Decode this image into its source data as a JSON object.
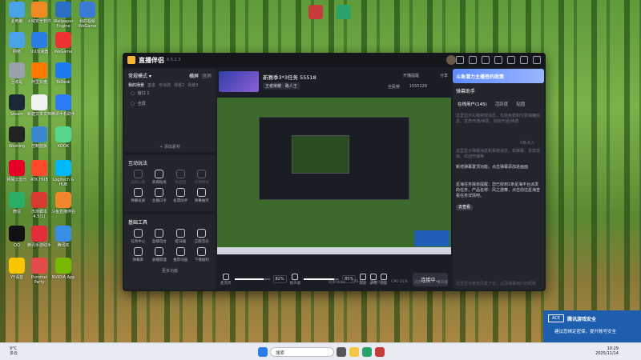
{
  "desktop": {
    "icons": [
      {
        "label": "此电脑",
        "color": "#4aa3e8"
      },
      {
        "label": "火绒安全软件",
        "color": "#f08a24"
      },
      {
        "label": "Wallpaper Engine",
        "color": "#2b6fc2"
      },
      {
        "label": "我的视频WeGame",
        "color": "#3a7bd5"
      },
      {
        "label": "网络",
        "color": "#4aa3e8"
      },
      {
        "label": "UU加速器",
        "color": "#2a7de1"
      },
      {
        "label": "WeGame",
        "color": "#e33"
      },
      {
        "label": "回收站",
        "color": "#9aa0ad"
      },
      {
        "label": "阿里云盘",
        "color": "#ff7a00"
      },
      {
        "label": "ToDesk",
        "color": "#1f7cf0"
      },
      {
        "label": "Steam",
        "color": "#1b2838"
      },
      {
        "label": "新建文本文档",
        "color": "#f2f2f2"
      },
      {
        "label": "腾讯手机助手",
        "color": "#2d7cf6"
      },
      {
        "label": "Wooting",
        "color": "#222"
      },
      {
        "label": "控制面板",
        "color": "#3a89d0"
      },
      {
        "label": "KOOK",
        "color": "#58d68d"
      },
      {
        "label": "网易云音乐",
        "color": "#e60026"
      },
      {
        "label": "ATK HUB",
        "color": "#ff4b2b"
      },
      {
        "label": "Logitech G HUB",
        "color": "#00b8fc"
      },
      {
        "label": "微信",
        "color": "#2aae67"
      },
      {
        "label": "市场脚本 4.5(1)",
        "color": "#d83a2f"
      },
      {
        "label": "斗鱼直播伴侣",
        "color": "#f2862c"
      },
      {
        "label": "QQ",
        "color": "#111"
      },
      {
        "label": "腾讯手游助手",
        "color": "#e12d39"
      },
      {
        "label": "腾讯欢",
        "color": "#3a8ee6"
      },
      {
        "label": "YY语音",
        "color": "#f9c400"
      },
      {
        "label": "Pummel Party",
        "color": "#e54b4b"
      },
      {
        "label": "NVIDIA App",
        "color": "#76b900"
      }
    ]
  },
  "app": {
    "title": "直播伴侣",
    "version": "6.5.2.3",
    "scenes": {
      "mode": "常规模式",
      "mode_icon": "chevron-down-icon",
      "view_options": [
        "横屏",
        "竖屏"
      ],
      "tabs": [
        "我的场景",
        "基金",
        "可涂改",
        "场景2",
        "场景3"
      ],
      "sources": [
        "窗口 1",
        "全屏"
      ],
      "add_source": "+ 添加素材"
    },
    "interaction": {
      "title": "互动玩法",
      "items": [
        {
          "label": "选择心愿",
          "active": false
        },
        {
          "label": "商城贴纸",
          "active": true
        },
        {
          "label": "粉丝团",
          "active": false
        },
        {
          "label": "礼物特效",
          "active": false
        },
        {
          "label": "弹幕投屏",
          "active": true
        },
        {
          "label": "主播口令",
          "active": true
        },
        {
          "label": "投票助手",
          "active": true
        },
        {
          "label": "弹幕抽奖",
          "active": true
        }
      ]
    },
    "tools": {
      "title": "基础工具",
      "items": [
        {
          "label": "任务中心"
        },
        {
          "label": "直播电台"
        },
        {
          "label": "提词器"
        },
        {
          "label": "正版音乐"
        },
        {
          "label": "弹幕库"
        },
        {
          "label": "录播管理"
        },
        {
          "label": "推荐动画"
        },
        {
          "label": "下播福利"
        }
      ],
      "more": "更多功能"
    },
    "stream": {
      "title": "新赛季3*3任务 55518",
      "category": "王者荣耀 · 路人王",
      "status": "开播提醒",
      "share": "分享",
      "viewers": "1555228",
      "lock": "全民禁"
    },
    "controls": {
      "mic_label": "麦克风",
      "mic_value": "82%",
      "mic_fill": 0.82,
      "speaker_label": "扬声器",
      "speaker_value": "85%",
      "speaker_fill": 0.85,
      "buttons": [
        "美颜",
        "录制",
        "设置"
      ],
      "start": "连接中..."
    },
    "statusbar": [
      "码率0kb/s",
      "FPS:60",
      "丢帧:0%",
      "CPU:21%",
      "内存:24%",
      "未开播"
    ],
    "right": {
      "ad": "斗鱼潜力主播签约政策",
      "heading": "弹幕助手",
      "tabs": [
        "在线用户(145)",
        "活跃度",
        "贴图"
      ],
      "messages": [
        {
          "text": "这里显示礼物特效消息，包括免费和付费礼物信息，发表开通/续费，钻粉开通/续费",
          "hl": false
        },
        {
          "text": "0.0",
          "hl": false
        },
        {
          "text": "0条点入",
          "hl": false
        },
        {
          "text": "这里显示弹幕消息和系统消息，如弹幕、贵宾进房、欢迎开播等",
          "hl": false
        },
        {
          "text": "新增弹幕置顶功能，点击弹幕添加进画面",
          "hl": true
        },
        {
          "text": "星海任务操单提醒：您已收到1条星海平台派发的任务，产品名称：风之游舞，点击前往星海查看任务详情吧。",
          "hl": true
        }
      ],
      "more_btn": "去查看",
      "input_hint": "这里显示麦克风发了言，以及弹幕用户的昵称"
    }
  },
  "taskbar": {
    "weather_temp": "9°C",
    "weather_desc": "多云",
    "search": "搜索",
    "time": "10:29",
    "date": "2025/11/14"
  },
  "toast": {
    "title": "腾讯游戏安全",
    "logo": "ACE",
    "body": "建议您绑定密保，提升账号安全"
  }
}
